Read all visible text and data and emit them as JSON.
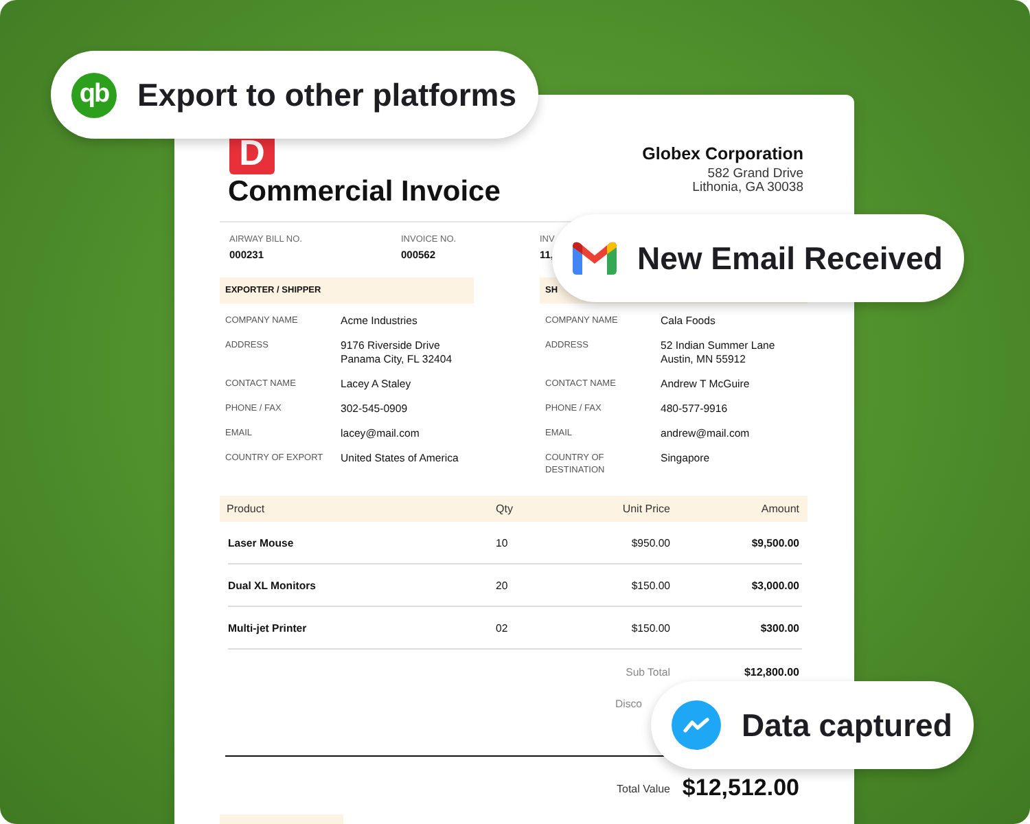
{
  "badges": [
    {
      "kind": "quickbooks",
      "logo_text": "qb",
      "text": "Export to other platforms"
    },
    {
      "kind": "gmail",
      "text": "New Email Received"
    },
    {
      "kind": "chart",
      "text": "Data captured"
    }
  ],
  "invoice": {
    "logo_text": "D",
    "title": "Commercial Invoice",
    "company": {
      "name": "Globex Corporation",
      "address_lines": [
        "582 Grand Drive",
        "Lithonia, GA 30038"
      ]
    },
    "meta": [
      {
        "label": "AIRWAY BILL NO.",
        "value": "000231"
      },
      {
        "label": "INVOICE NO.",
        "value": "000562"
      },
      {
        "label": "INV",
        "value": "11,"
      }
    ],
    "sections": [
      {
        "heading": "EXPORTER / SHIPPER",
        "fields": [
          {
            "label": [
              "COMPANY NAME"
            ],
            "value": [
              "Acme Industries"
            ]
          },
          {
            "label": [
              "ADDRESS"
            ],
            "value": [
              "9176 Riverside Drive",
              "Panama City, FL 32404"
            ]
          },
          {
            "label": [
              "CONTACT NAME"
            ],
            "value": [
              "Lacey A Staley"
            ]
          },
          {
            "label": [
              "PHONE / FAX"
            ],
            "value": [
              "302-545-0909"
            ]
          },
          {
            "label": [
              "EMAIL"
            ],
            "value": [
              "lacey@mail.com"
            ]
          },
          {
            "label": [
              "COUNTRY OF EXPORT"
            ],
            "value": [
              "United States of America"
            ]
          }
        ]
      },
      {
        "heading": "SH",
        "fields": [
          {
            "label": [
              "COMPANY NAME"
            ],
            "value": [
              "Cala Foods"
            ]
          },
          {
            "label": [
              "ADDRESS"
            ],
            "value": [
              "52 Indian Summer Lane",
              "Austin, MN 55912"
            ]
          },
          {
            "label": [
              "CONTACT NAME"
            ],
            "value": [
              "Andrew T McGuire"
            ]
          },
          {
            "label": [
              "PHONE / FAX"
            ],
            "value": [
              "480-577-9916"
            ]
          },
          {
            "label": [
              "EMAIL"
            ],
            "value": [
              "andrew@mail.com"
            ]
          },
          {
            "label": [
              "COUNTRY OF",
              "DESTINATION"
            ],
            "value": [
              "Singapore"
            ]
          }
        ]
      }
    ],
    "table": {
      "columns": [
        "Product",
        "Qty",
        "Unit Price",
        "Amount"
      ],
      "rows": [
        [
          "Laser Mouse",
          "10",
          "$950.00",
          "$9,500.00"
        ],
        [
          "Dual XL Monitors",
          "20",
          "$150.00",
          "$3,000.00"
        ],
        [
          "Multi-jet Printer",
          "02",
          "$150.00",
          "$300.00"
        ]
      ]
    },
    "totals": [
      {
        "label": "Sub Total",
        "value": "$12,800.00"
      },
      {
        "label": "Disco"
      }
    ],
    "total_value": {
      "label": "Total Value",
      "value": "$12,512.00"
    }
  }
}
